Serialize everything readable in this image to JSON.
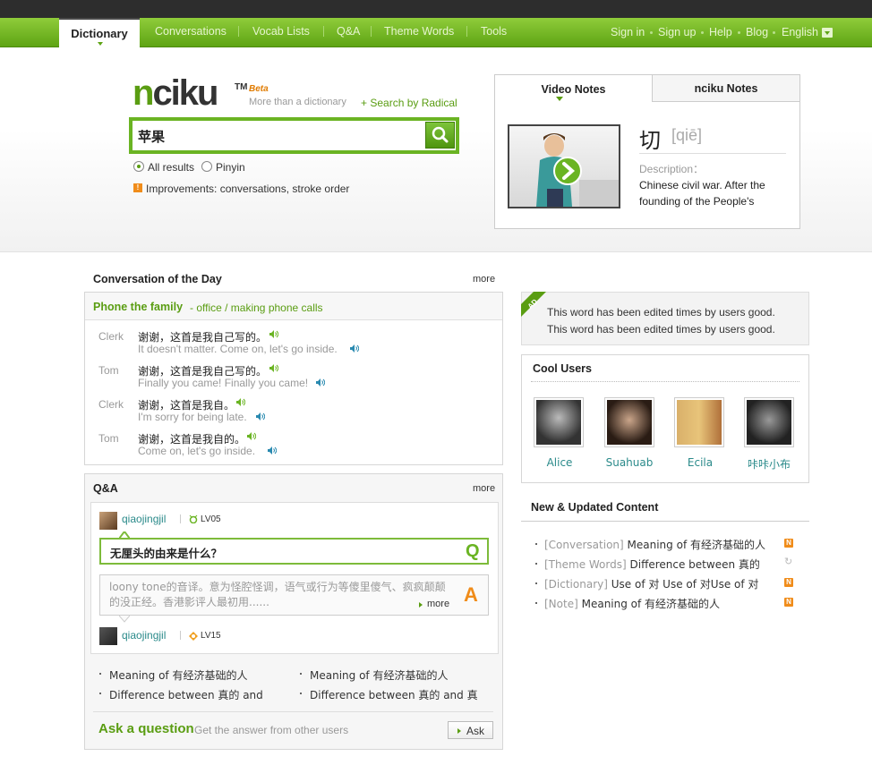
{
  "nav": {
    "tabs": [
      "Dictionary",
      "Conversations",
      "Vocab Lists",
      "Q&A",
      "Theme Words",
      "Tools"
    ],
    "right": [
      "Sign in",
      "Sign up",
      "Help",
      "Blog",
      "English"
    ]
  },
  "brand": {
    "logo": "nciku",
    "tm": "TM",
    "beta": "Beta",
    "tagline": "More than a dictionary",
    "radical_link": "+ Search by Radical"
  },
  "search": {
    "value": "苹果",
    "opt_all": "All results",
    "opt_pinyin": "Pinyin",
    "improvements": "Improvements: conversations, stroke order"
  },
  "video": {
    "tab1": "Video Notes",
    "tab2": "nciku Notes",
    "char": "切",
    "pinyin": "[qiē]",
    "desc_label": "Description：",
    "desc": "Chinese civil war. After the founding of the People's"
  },
  "cod": {
    "title": "Conversation of the Day",
    "more": "more",
    "topic": "Phone the family",
    "sub": "- office / making phone calls",
    "lines": [
      {
        "who": "Clerk",
        "zh": "谢谢，这首是我自己写的。",
        "en": "It doesn't matter. Come on, let's go inside."
      },
      {
        "who": "Tom",
        "zh": "谢谢，这首是我自己写的。",
        "en": "Finally you came! Finally you came!"
      },
      {
        "who": "Clerk",
        "zh": "谢谢，这首是我自。",
        "en": "I'm sorry for being late."
      },
      {
        "who": "Tom",
        "zh": "谢谢，这首是我自的。",
        "en": "Come on, let's go inside."
      }
    ]
  },
  "qa": {
    "title": "Q&A",
    "more": "more",
    "asker": "qiaojingjil",
    "asker_lv": "LV05",
    "question": "无厘头的由来是什么？",
    "qmark": "Q",
    "answer": "loony tone的音译。意为怪腔怪调，语气或行为等傻里傻气、疯疯颠颠的没正经。香港影评人最初用......",
    "amark": "A",
    "answer_more": "more",
    "answerer": "qiaojingjil",
    "answerer_lv": "LV15",
    "list": [
      "Meaning of 有经济基础的人",
      "Meaning of 有经济基础的人",
      "Difference between 真的 and",
      "Difference between 真的 and 真"
    ],
    "ask_title": "Ask a question",
    "ask_sub": "Get the answer from other users",
    "ask_btn": "Ask"
  },
  "ad": {
    "tag": "AD",
    "line1": "This word has been edited times by users good.",
    "line2": "This word has been edited times by users good."
  },
  "cool": {
    "title": "Cool Users",
    "users": [
      "Alice",
      "Suahuab",
      "Ecila",
      "咔咔小布"
    ]
  },
  "updates": {
    "title": "New & Updated Content",
    "items": [
      {
        "tag": "[Conversation]",
        "text": "Meaning of 有经济基础的人",
        "badge": "N"
      },
      {
        "tag": "[Theme Words]",
        "text": "Difference between 真的",
        "badge": "↻"
      },
      {
        "tag": "[Dictionary]",
        "text": "Use of 对 Use of 对Use of 对",
        "badge": "N"
      },
      {
        "tag": "[Note]",
        "text": "Meaning of 有经济基础的人",
        "badge": "N"
      }
    ]
  }
}
